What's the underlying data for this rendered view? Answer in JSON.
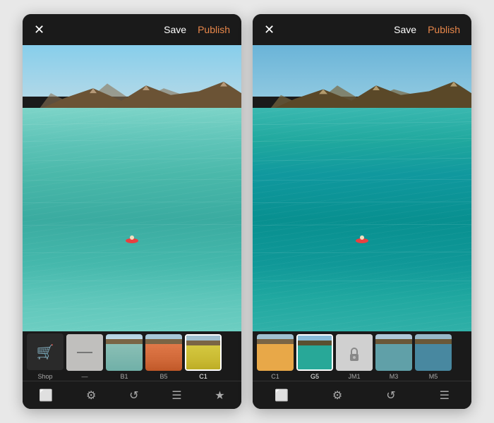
{
  "panels": [
    {
      "id": "left",
      "topBar": {
        "closeLabel": "✕",
        "saveLabel": "Save",
        "publishLabel": "Publish"
      },
      "filters": {
        "shopLabel": "Shop",
        "items": [
          {
            "id": "dash",
            "label": "—",
            "type": "dash",
            "selected": false
          },
          {
            "id": "B1",
            "label": "B1",
            "type": "warm",
            "selected": false
          },
          {
            "id": "B5",
            "label": "B5",
            "type": "cool",
            "selected": false
          },
          {
            "id": "C1",
            "label": "C1",
            "type": "vivid",
            "selected": true
          }
        ]
      },
      "toolbar": {
        "icons": [
          "⬜",
          "⚙",
          "↺",
          "☰",
          "★"
        ]
      }
    },
    {
      "id": "right",
      "topBar": {
        "closeLabel": "✕",
        "saveLabel": "Save",
        "publishLabel": "Publish"
      },
      "filters": {
        "items": [
          {
            "id": "C1",
            "label": "C1",
            "type": "warm",
            "selected": false
          },
          {
            "id": "G5",
            "label": "G5",
            "type": "green",
            "selected": true
          },
          {
            "id": "JM1-lock",
            "label": "JM1",
            "type": "lock",
            "selected": false
          },
          {
            "id": "M3",
            "label": "M3",
            "type": "muted",
            "selected": false
          },
          {
            "id": "M5",
            "label": "M5",
            "type": "cool2",
            "selected": false
          }
        ]
      },
      "toolbar": {
        "icons": [
          "⬜",
          "⚙",
          "↺",
          "☰"
        ]
      }
    }
  ]
}
